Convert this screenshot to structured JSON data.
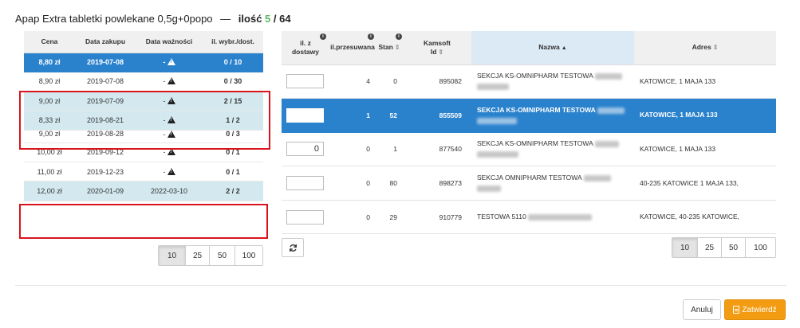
{
  "dialog": {
    "product_name": "Apap Extra tabletki powlekane 0,5g+0popo",
    "separator": "—",
    "qty_label": "ilość",
    "qty_selected": "5",
    "qty_slash": " / ",
    "qty_total": "64"
  },
  "batches": {
    "headers": [
      "Cena",
      "Data zakupu",
      "Data ważności",
      "il. wybr./dost."
    ],
    "rows": [
      {
        "price": "8,80 zł",
        "purchase": "2019-07-08",
        "expiry": "-",
        "warn": true,
        "qty": "0 / 10",
        "selected": true
      },
      {
        "price": "8,90 zł",
        "purchase": "2019-07-08",
        "expiry": "-",
        "warn": true,
        "qty": "0 / 30"
      },
      {
        "price": "9,00 zł",
        "purchase": "2019-07-09",
        "expiry": "-",
        "warn": true,
        "qty": "2 / 15"
      },
      {
        "price": "8,33 zł",
        "purchase": "2019-08-21",
        "expiry": "-",
        "warn": true,
        "qty": "1 / 2"
      },
      {
        "price": "9,00 zł",
        "purchase": "2019-08-28",
        "expiry": "-",
        "warn": true,
        "qty": "0 / 3"
      },
      {
        "price": "10,00 zł",
        "purchase": "2019-09-12",
        "expiry": "-",
        "warn": true,
        "qty": "0 / 1"
      },
      {
        "price": "11,00 zł",
        "purchase": "2019-12-23",
        "expiry": "-",
        "warn": true,
        "qty": "0 / 1"
      },
      {
        "price": "12,00 zł",
        "purchase": "2020-01-09",
        "expiry": "2022-03-10",
        "warn": false,
        "qty": "2 / 2"
      }
    ],
    "page_sizes": [
      "10",
      "25",
      "50",
      "100"
    ],
    "active_page_size": "10"
  },
  "pharmacies": {
    "headers": {
      "delivery": [
        "il. z",
        "dostawy"
      ],
      "moved": "il.przesuwana",
      "stock": "Stan",
      "kamsoft": [
        "Kamsoft",
        "Id"
      ],
      "name": "Nazwa",
      "address": "Adres"
    },
    "rows": [
      {
        "input": "",
        "moved": "4",
        "stock": "0",
        "id": "895082",
        "name": "SEKCJA KS-OMNIPHARM TESTOWA",
        "address": "KATOWICE, 1 MAJA 133"
      },
      {
        "input": "",
        "moved": "1",
        "stock": "52",
        "id": "855509",
        "name": "SEKCJA KS-OMNIPHARM TESTOWA",
        "address": "KATOWICE, 1 MAJA 133",
        "selected": true
      },
      {
        "input": "0",
        "moved": "0",
        "stock": "1",
        "id": "877540",
        "name": "SEKCJA KS-OMNIPHARM TESTOWA",
        "address": "KATOWICE, 1 MAJA 133"
      },
      {
        "input": "",
        "moved": "0",
        "stock": "80",
        "id": "898273",
        "name": "SEKCJA OMNIPHARM TESTOWA",
        "address": "40-235 KATOWICE 1 MAJA 133,"
      },
      {
        "input": "",
        "moved": "0",
        "stock": "29",
        "id": "910779",
        "name": "TESTOWA 5110",
        "address": "KATOWICE, 40-235 KATOWICE,"
      }
    ],
    "page_sizes": [
      "10",
      "25",
      "50",
      "100"
    ],
    "active_page_size": "10"
  },
  "footer": {
    "cancel_label": "Anuluj",
    "confirm_label": "Zatwierdź"
  },
  "icons": {
    "warning": "warning-triangle-icon",
    "info": "info-circle-icon",
    "sort": "sort-icon",
    "refresh": "refresh-icon",
    "confirm": "document-icon"
  },
  "colors": {
    "selected_row": "#2a82cd",
    "highlight_row": "#d3e9ef",
    "annotation_box": "#d9141c",
    "confirm_button": "#f39c12",
    "qty_selected": "#5cb85c"
  }
}
